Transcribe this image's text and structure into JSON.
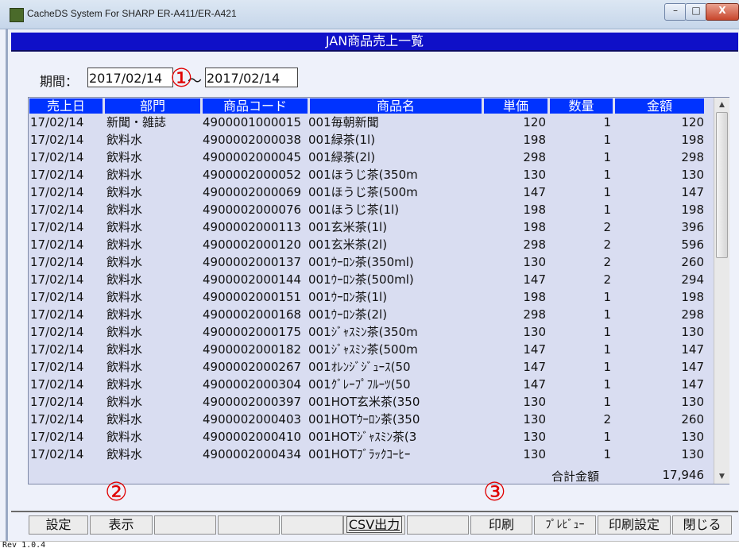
{
  "window": {
    "title": "CacheDS System For SHARP ER-A411/ER-A421",
    "min_glyph": "–",
    "max_glyph": "□",
    "close_glyph": "X"
  },
  "header": {
    "title": "JAN商品売上一覧"
  },
  "period": {
    "label": "期間：",
    "from": "2017/02/14",
    "separator": "～",
    "to": "2017/02/14"
  },
  "annotations": {
    "one": "①",
    "two": "②",
    "three": "③",
    "color": "#e00000"
  },
  "table": {
    "headers": {
      "date": "売上日",
      "dept": "部門",
      "code": "商品コード",
      "name": "商品名",
      "price": "単価",
      "qty": "数量",
      "amount": "金額"
    },
    "rows": [
      {
        "date": "17/02/14",
        "dept": "新聞・雑誌",
        "code": "4900001000015",
        "name": "001毎朝新聞",
        "price": "120",
        "qty": "1",
        "amount": "120"
      },
      {
        "date": "17/02/14",
        "dept": "飲料水",
        "code": "4900002000038",
        "name": "001緑茶(1l)",
        "price": "198",
        "qty": "1",
        "amount": "198"
      },
      {
        "date": "17/02/14",
        "dept": "飲料水",
        "code": "4900002000045",
        "name": "001緑茶(2l)",
        "price": "298",
        "qty": "1",
        "amount": "298"
      },
      {
        "date": "17/02/14",
        "dept": "飲料水",
        "code": "4900002000052",
        "name": "001ほうじ茶(350m",
        "price": "130",
        "qty": "1",
        "amount": "130"
      },
      {
        "date": "17/02/14",
        "dept": "飲料水",
        "code": "4900002000069",
        "name": "001ほうじ茶(500m",
        "price": "147",
        "qty": "1",
        "amount": "147"
      },
      {
        "date": "17/02/14",
        "dept": "飲料水",
        "code": "4900002000076",
        "name": "001ほうじ茶(1l)",
        "price": "198",
        "qty": "1",
        "amount": "198"
      },
      {
        "date": "17/02/14",
        "dept": "飲料水",
        "code": "4900002000113",
        "name": "001玄米茶(1l)",
        "price": "198",
        "qty": "2",
        "amount": "396"
      },
      {
        "date": "17/02/14",
        "dept": "飲料水",
        "code": "4900002000120",
        "name": "001玄米茶(2l)",
        "price": "298",
        "qty": "2",
        "amount": "596"
      },
      {
        "date": "17/02/14",
        "dept": "飲料水",
        "code": "4900002000137",
        "name": "001ｳｰﾛﾝ茶(350ml)",
        "price": "130",
        "qty": "2",
        "amount": "260"
      },
      {
        "date": "17/02/14",
        "dept": "飲料水",
        "code": "4900002000144",
        "name": "001ｳｰﾛﾝ茶(500ml)",
        "price": "147",
        "qty": "2",
        "amount": "294"
      },
      {
        "date": "17/02/14",
        "dept": "飲料水",
        "code": "4900002000151",
        "name": "001ｳｰﾛﾝ茶(1l)",
        "price": "198",
        "qty": "1",
        "amount": "198"
      },
      {
        "date": "17/02/14",
        "dept": "飲料水",
        "code": "4900002000168",
        "name": "001ｳｰﾛﾝ茶(2l)",
        "price": "298",
        "qty": "1",
        "amount": "298"
      },
      {
        "date": "17/02/14",
        "dept": "飲料水",
        "code": "4900002000175",
        "name": "001ｼﾞｬｽﾐﾝ茶(350m",
        "price": "130",
        "qty": "1",
        "amount": "130"
      },
      {
        "date": "17/02/14",
        "dept": "飲料水",
        "code": "4900002000182",
        "name": "001ｼﾞｬｽﾐﾝ茶(500m",
        "price": "147",
        "qty": "1",
        "amount": "147"
      },
      {
        "date": "17/02/14",
        "dept": "飲料水",
        "code": "4900002000267",
        "name": "001ｵﾚﾝｼﾞｼﾞｭｰｽ(50",
        "price": "147",
        "qty": "1",
        "amount": "147"
      },
      {
        "date": "17/02/14",
        "dept": "飲料水",
        "code": "4900002000304",
        "name": "001ｸﾞﾚｰﾌﾟﾌﾙｰﾂ(50",
        "price": "147",
        "qty": "1",
        "amount": "147"
      },
      {
        "date": "17/02/14",
        "dept": "飲料水",
        "code": "4900002000397",
        "name": "001HOT玄米茶(350",
        "price": "130",
        "qty": "1",
        "amount": "130"
      },
      {
        "date": "17/02/14",
        "dept": "飲料水",
        "code": "4900002000403",
        "name": "001HOTｳｰﾛﾝ茶(350",
        "price": "130",
        "qty": "2",
        "amount": "260"
      },
      {
        "date": "17/02/14",
        "dept": "飲料水",
        "code": "4900002000410",
        "name": "001HOTｼﾞｬｽﾐﾝ茶(3",
        "price": "130",
        "qty": "1",
        "amount": "130"
      },
      {
        "date": "17/02/14",
        "dept": "飲料水",
        "code": "4900002000434",
        "name": "001HOTﾌﾞﾗｯｸｺｰﾋｰ",
        "price": "130",
        "qty": "1",
        "amount": "130"
      }
    ],
    "total_label": "合計金額",
    "total_value": "17,946"
  },
  "buttons": {
    "settings": "設定",
    "display": "表示",
    "csv": "CSV出力",
    "print": "印刷",
    "preview": "ﾌﾟﾚﾋﾞｭｰ",
    "print_settings": "印刷設定",
    "close": "閉じる"
  },
  "status": {
    "version": "Rev 1.0.4"
  },
  "colors": {
    "header_band": "#0f10c8",
    "column_header": "#0033ff",
    "grid_bg": "#d9ddf1",
    "window_bg": "#eef1fa"
  }
}
